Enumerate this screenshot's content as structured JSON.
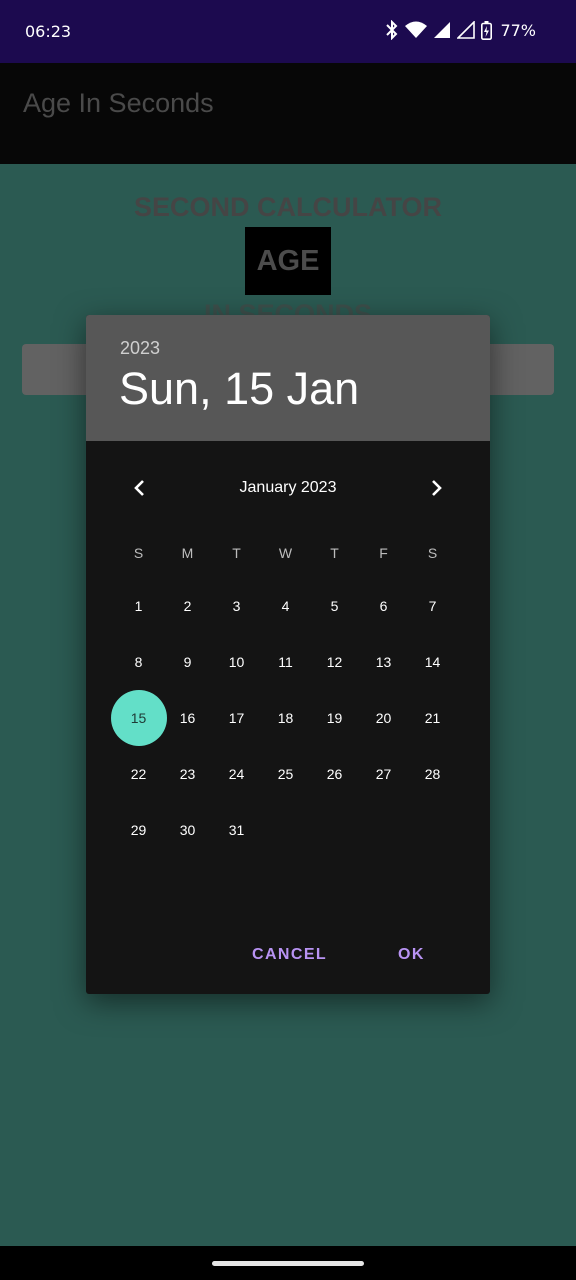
{
  "status_bar": {
    "time": "06:23",
    "battery": "77%",
    "icons": [
      "bluetooth-icon",
      "wifi-icon",
      "signal-icon",
      "signal-icon",
      "battery-charging-icon"
    ]
  },
  "app_bar": {
    "title": "Age In Seconds"
  },
  "main": {
    "heading": "SECOND CALCULATOR",
    "age_label": "AGE",
    "in_seconds": "IN SECONDS"
  },
  "dialog": {
    "year": "2023",
    "date": "Sun, 15 Jan",
    "month_label": "January 2023",
    "prev_icon": "chevron-left-icon",
    "next_icon": "chevron-right-icon",
    "weekdays": [
      "S",
      "M",
      "T",
      "W",
      "T",
      "F",
      "S"
    ],
    "days": [
      "1",
      "2",
      "3",
      "4",
      "5",
      "6",
      "7",
      "8",
      "9",
      "10",
      "11",
      "12",
      "13",
      "14",
      "15",
      "16",
      "17",
      "18",
      "19",
      "20",
      "21",
      "22",
      "23",
      "24",
      "25",
      "26",
      "27",
      "28",
      "29",
      "30",
      "31"
    ],
    "selected_day": "15",
    "cancel_label": "CANCEL",
    "ok_label": "OK",
    "accent_color": "#63dfc8",
    "button_color": "#b893f3"
  }
}
